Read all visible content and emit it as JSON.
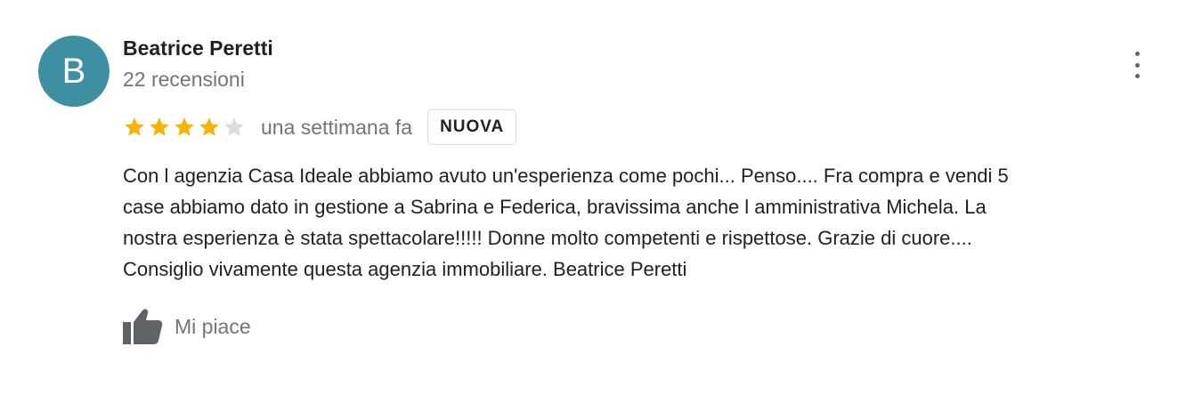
{
  "review": {
    "avatar_initial": "B",
    "avatar_color": "#3f8fa2",
    "author_name": "Beatrice Peretti",
    "review_count": "22 recensioni",
    "rating": 4,
    "max_rating": 5,
    "star_filled_color": "#f4b400",
    "star_empty_color": "#dadce0",
    "time_ago": "una settimana fa",
    "badge": "NUOVA",
    "text": "Con l agenzia Casa Ideale abbiamo avuto un'esperienza come pochi... Penso.... Fra compra e vendi 5\ncase abbiamo dato in gestione a Sabrina e Federica, bravissima anche l amministrativa Michela. La\nnostra esperienza è  stata spettacolare!!!!! Donne molto competenti e rispettose. Grazie  di cuore....\nConsiglio vivamente questa agenzia  immobiliare. Beatrice Peretti",
    "like_label": "Mi piace",
    "more_icon": "more-vert-icon",
    "like_icon": "thumbs-up-icon"
  }
}
